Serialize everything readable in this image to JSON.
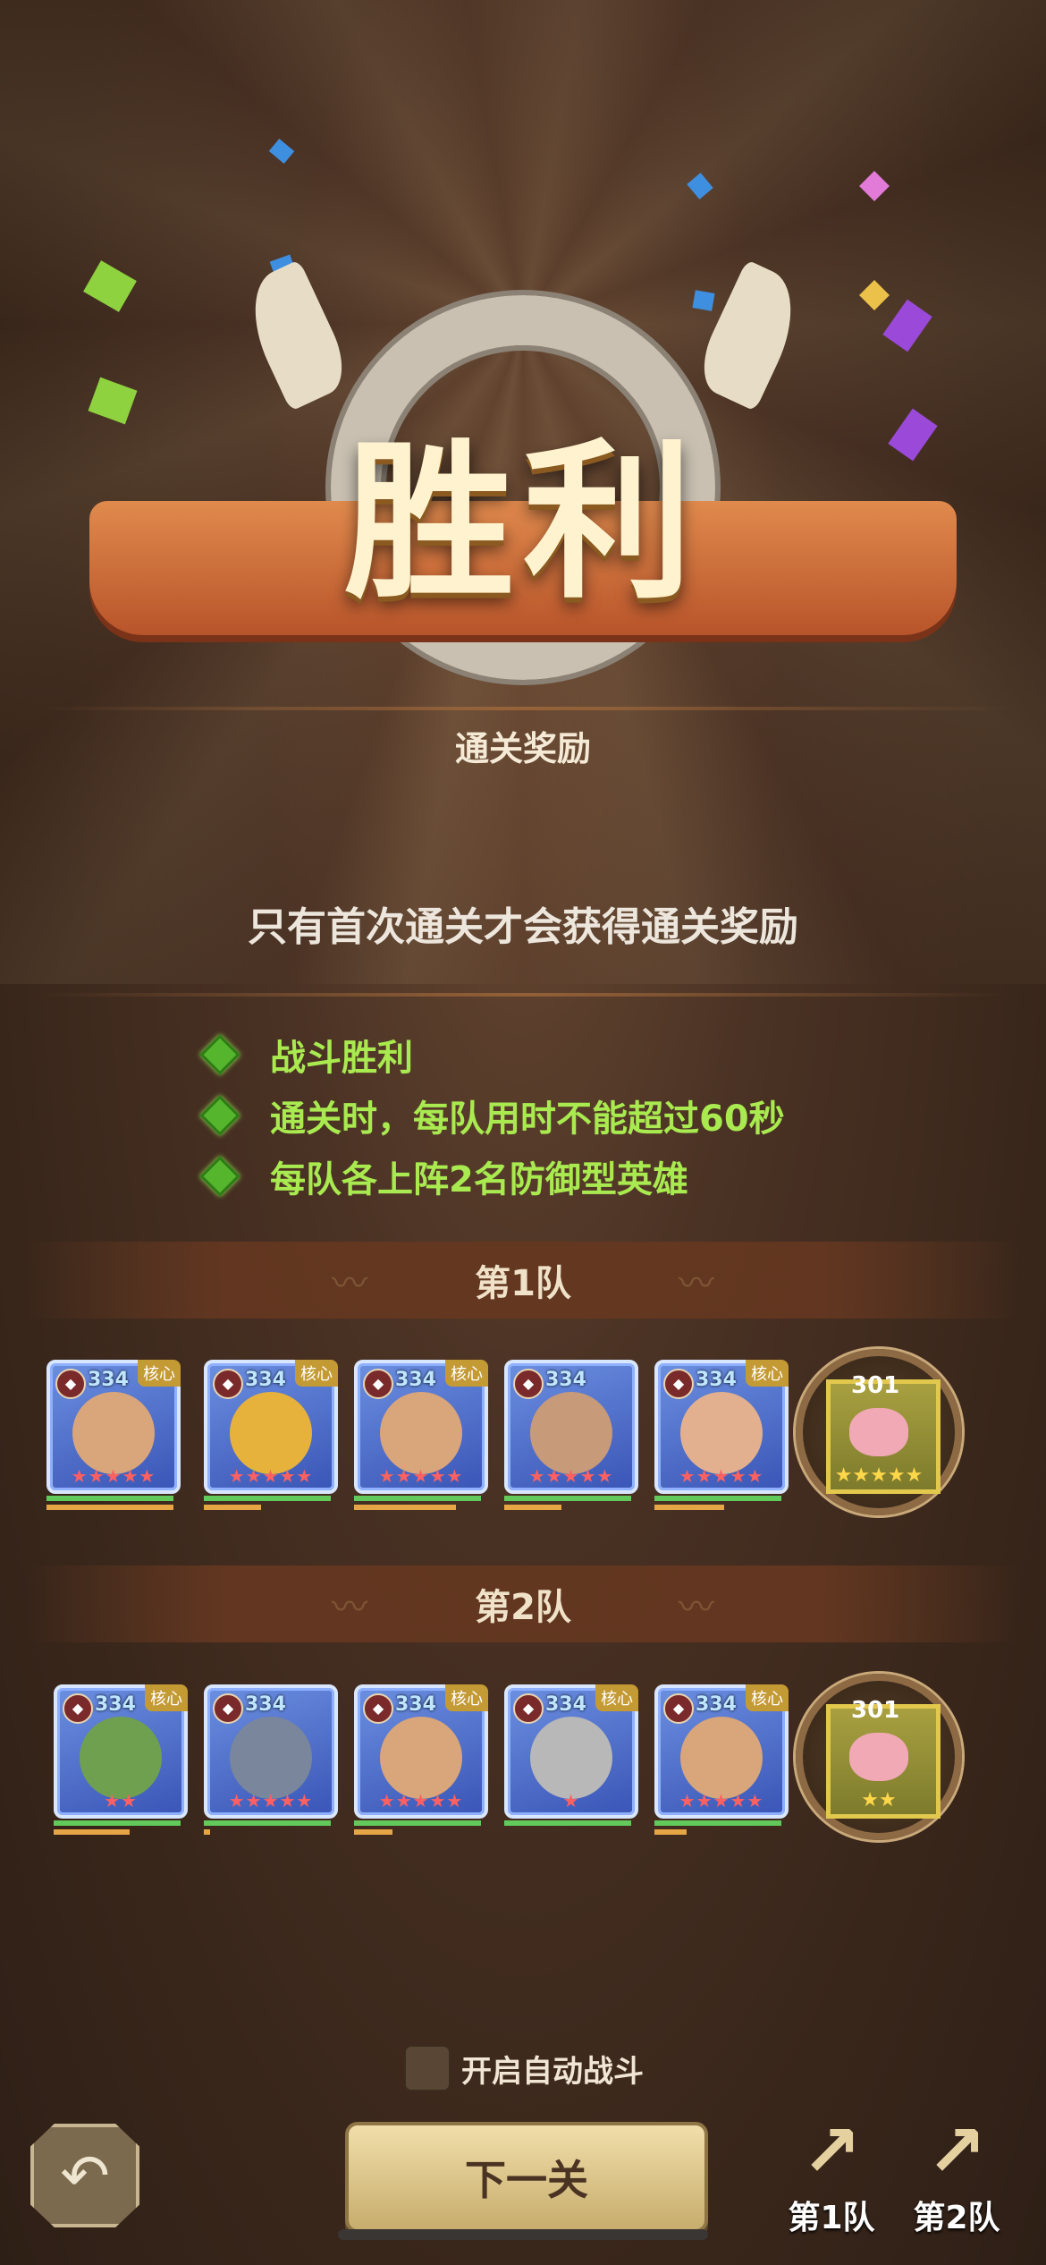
{
  "title": "胜利",
  "reward_header": "通关奖励",
  "notice": "只有首次通关才会获得通关奖励",
  "conditions": [
    "战斗胜利",
    "通关时，每队用时不能超过60秒",
    "每队各上阵2名防御型英雄"
  ],
  "team1": {
    "label": "第1队",
    "heroes": [
      {
        "level": "334",
        "core": "核心",
        "stars": "★★★★★"
      },
      {
        "level": "334",
        "core": "核心",
        "stars": "★★★★★"
      },
      {
        "level": "334",
        "core": "核心",
        "stars": "★★★★★"
      },
      {
        "level": "334",
        "core": "",
        "stars": "★★★★★"
      },
      {
        "level": "334",
        "core": "核心",
        "stars": "★★★★★"
      }
    ],
    "pet": {
      "level": "301",
      "stars": "★★★★★"
    }
  },
  "team2": {
    "label": "第2队",
    "heroes": [
      {
        "level": "334",
        "core": "核心",
        "stars": "★★"
      },
      {
        "level": "334",
        "core": "",
        "stars": "★★★★★"
      },
      {
        "level": "334",
        "core": "核心",
        "stars": "★★★★★"
      },
      {
        "level": "334",
        "core": "核心",
        "stars": "★"
      },
      {
        "level": "334",
        "core": "核心",
        "stars": "★★★★★"
      }
    ],
    "pet": {
      "level": "301",
      "stars": "★★"
    }
  },
  "auto_battle_label": "开启自动战斗",
  "next_button": "下一关",
  "team_buttons": [
    "第1队",
    "第2队"
  ],
  "colors": {
    "accent_green": "#a8ea4f",
    "button_gold": "#e4cc8e",
    "background": "#3a271b"
  }
}
